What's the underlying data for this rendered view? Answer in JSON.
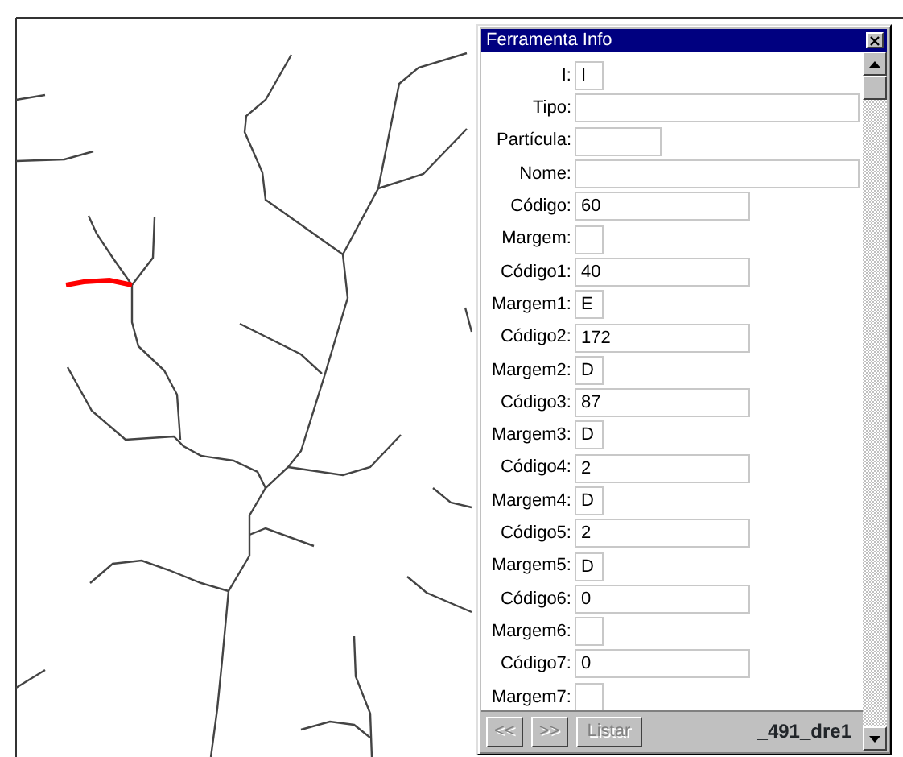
{
  "window": {
    "title": "Ferramenta Info"
  },
  "fields": [
    {
      "label": "I:",
      "value": "I",
      "kind": "tiny"
    },
    {
      "label": "Tipo:",
      "kind": "long"
    },
    {
      "label": "Partícula:",
      "kind": "medium"
    },
    {
      "label": "Nome:",
      "kind": "long"
    },
    {
      "label": "Código:",
      "value": "60",
      "kind": "code"
    },
    {
      "label": "Margem:",
      "kind": "tiny"
    },
    {
      "label": "Código1:",
      "value": "40",
      "kind": "code"
    },
    {
      "label": "Margem1:",
      "value": "E",
      "kind": "tiny"
    },
    {
      "label": "Código2:",
      "value": "172",
      "kind": "code"
    },
    {
      "label": "Margem2:",
      "value": "D",
      "kind": "tiny"
    },
    {
      "label": "Código3:",
      "value": "87",
      "kind": "code"
    },
    {
      "label": "Margem3:",
      "value": "D",
      "kind": "tiny"
    },
    {
      "label": "Código4:",
      "value": "2",
      "kind": "code"
    },
    {
      "label": "Margem4:",
      "value": "D",
      "kind": "tiny"
    },
    {
      "label": "Código5:",
      "value": "2",
      "kind": "code"
    },
    {
      "label": "Margem5:",
      "value": "D",
      "kind": "tiny"
    },
    {
      "label": "Código6:",
      "value": "0",
      "kind": "code"
    },
    {
      "label": "Margem6:",
      "kind": "tiny"
    },
    {
      "label": "Código7:",
      "value": "0",
      "kind": "code"
    },
    {
      "label": "Margem7:",
      "kind": "tiny"
    }
  ],
  "buttons": [
    {
      "label": "<<",
      "disabled": true
    },
    {
      "label": ">>",
      "disabled": true
    },
    {
      "label": "Listar",
      "disabled": true
    }
  ],
  "status": "_491_dre1"
}
